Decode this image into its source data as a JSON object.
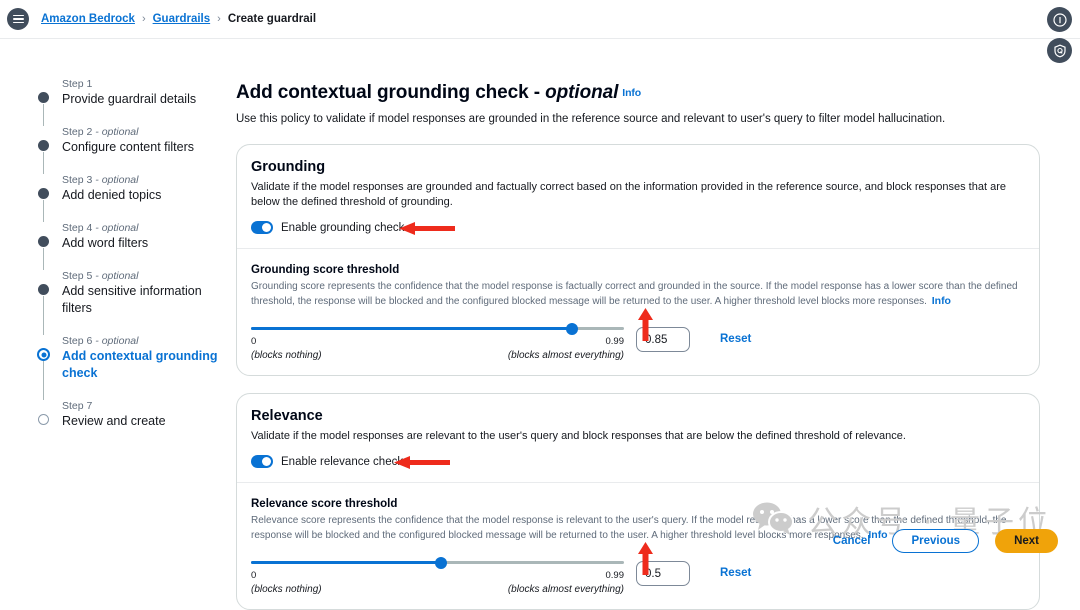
{
  "topbar": {
    "menu_icon": "hamburger-menu-icon",
    "breadcrumb": [
      {
        "label": "Amazon Bedrock",
        "link": true
      },
      {
        "label": "Guardrails",
        "link": true
      },
      {
        "label": "Create guardrail",
        "link": false
      }
    ],
    "separator": "›",
    "corner_buttons": [
      {
        "icon": "info-circle-icon",
        "glyph": "ⓘ"
      },
      {
        "icon": "shield-help-icon",
        "glyph": "⌘"
      }
    ]
  },
  "sidebar": {
    "steps": [
      {
        "num": "Step 1",
        "optional": "",
        "label": "Provide guardrail details",
        "state": "done"
      },
      {
        "num": "Step 2",
        "optional": " - optional",
        "label": "Configure content filters",
        "state": "done"
      },
      {
        "num": "Step 3",
        "optional": " - optional",
        "label": "Add denied topics",
        "state": "done"
      },
      {
        "num": "Step 4",
        "optional": " - optional",
        "label": "Add word filters",
        "state": "done"
      },
      {
        "num": "Step 5",
        "optional": " - optional",
        "label": "Add sensitive information filters",
        "state": "done"
      },
      {
        "num": "Step 6",
        "optional": " - optional",
        "label": "Add contextual grounding check",
        "state": "active"
      },
      {
        "num": "Step 7",
        "optional": "",
        "label": "Review and create",
        "state": "pending"
      }
    ]
  },
  "page": {
    "title_main": "Add contextual grounding check - ",
    "title_optional": "optional",
    "info_label": "Info",
    "description": "Use this policy to validate if model responses are grounded in the reference source and relevant to user's query to filter model hallucination."
  },
  "grounding": {
    "title": "Grounding",
    "description": "Validate if the model responses are grounded and factually correct based on the information provided in the reference source, and block responses that are below the defined threshold of grounding.",
    "toggle_label": "Enable grounding check",
    "toggle_on": true,
    "threshold_title": "Grounding score threshold",
    "threshold_desc": "Grounding score represents the confidence that the model response is factually correct and grounded in the source. If the model response has a lower score than the defined threshold, the response will be blocked and the configured blocked message will be returned to the user. A higher threshold level blocks more responses.",
    "threshold_info": "Info",
    "slider_min": "0",
    "slider_max": "0.99",
    "min_note": "(blocks nothing)",
    "max_note": "(blocks almost everything)",
    "value": "0.85",
    "percent": 86,
    "reset_label": "Reset"
  },
  "relevance": {
    "title": "Relevance",
    "description": "Validate if the model responses are relevant to the user's query and block responses that are below the defined threshold of relevance.",
    "toggle_label": "Enable relevance check",
    "toggle_on": true,
    "threshold_title": "Relevance score threshold",
    "threshold_desc": "Relevance score represents the confidence that the model response is relevant to the user's query. If the model response has a lower score than the defined threshold, the response will be blocked and the configured blocked message will be returned to the user. A higher threshold level blocks more responses.",
    "threshold_info": "Info",
    "slider_min": "0",
    "slider_max": "0.99",
    "min_note": "(blocks nothing)",
    "max_note": "(blocks almost everything)",
    "value": "0.5",
    "percent": 51,
    "reset_label": "Reset"
  },
  "footer": {
    "cancel_label": "Cancel",
    "previous_label": "Previous",
    "next_label": "Next"
  },
  "watermark": {
    "icon": "wechat-icon",
    "text": "公众号 · 量子位"
  }
}
